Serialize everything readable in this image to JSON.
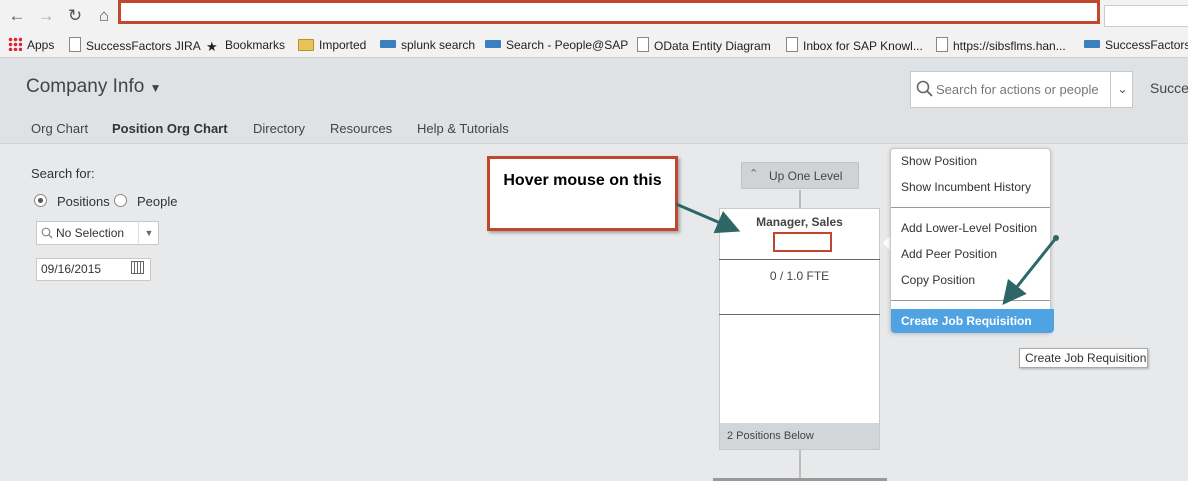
{
  "browser": {
    "nav_icons": [
      "back-arrow-icon",
      "forward-arrow-icon",
      "reload-icon",
      "home-icon"
    ],
    "bookmarks": [
      {
        "label": "Apps",
        "icon": "apps-grid-icon"
      },
      {
        "label": "SuccessFactors JIRA",
        "icon": "page-icon"
      },
      {
        "label": "Bookmarks",
        "icon": "star-icon"
      },
      {
        "label": "Imported",
        "icon": "folder-icon"
      },
      {
        "label": "splunk search",
        "icon": "sap-icon"
      },
      {
        "label": "Search - People@SAP",
        "icon": "sap-icon"
      },
      {
        "label": "OData Entity Diagram",
        "icon": "page-icon"
      },
      {
        "label": "Inbox for SAP Knowl...",
        "icon": "page-icon"
      },
      {
        "label": "https://sibsflms.han...",
        "icon": "page-icon"
      },
      {
        "label": "SuccessFactors l",
        "icon": "sap-icon"
      }
    ]
  },
  "header": {
    "title": "Company Info",
    "search_placeholder": "Search for actions or people",
    "user_name": "Success"
  },
  "tabs": [
    "Org Chart",
    "Position Org Chart",
    "Directory",
    "Resources",
    "Help & Tutorials"
  ],
  "active_tab": "Position Org Chart",
  "left_panel": {
    "search_for_label": "Search for:",
    "radio_positions": "Positions",
    "radio_people": "People",
    "selected_radio": "Positions",
    "selection_value": "No Selection",
    "date_value": "09/16/2015"
  },
  "org_chart": {
    "up_level_label": "Up One Level",
    "position_title": "Manager, Sales",
    "fte": "0 / 1.0 FTE",
    "positions_below": "2 Positions Below"
  },
  "context_menu": {
    "group1": [
      "Show Position",
      "Show Incumbent History"
    ],
    "group2": [
      "Add Lower-Level Position",
      "Add Peer Position",
      "Copy Position"
    ],
    "highlighted": "Create Job Requisition"
  },
  "tooltip": "Create Job Requisition",
  "annotation": {
    "callout_text": "Hover mouse on this",
    "border_color": "#c0462e",
    "arrow_color": "#2d6665"
  },
  "colors": {
    "highlight": "#4fa3e2",
    "page_bg": "#e7e9eb",
    "header_bg": "#dfe2e5"
  }
}
